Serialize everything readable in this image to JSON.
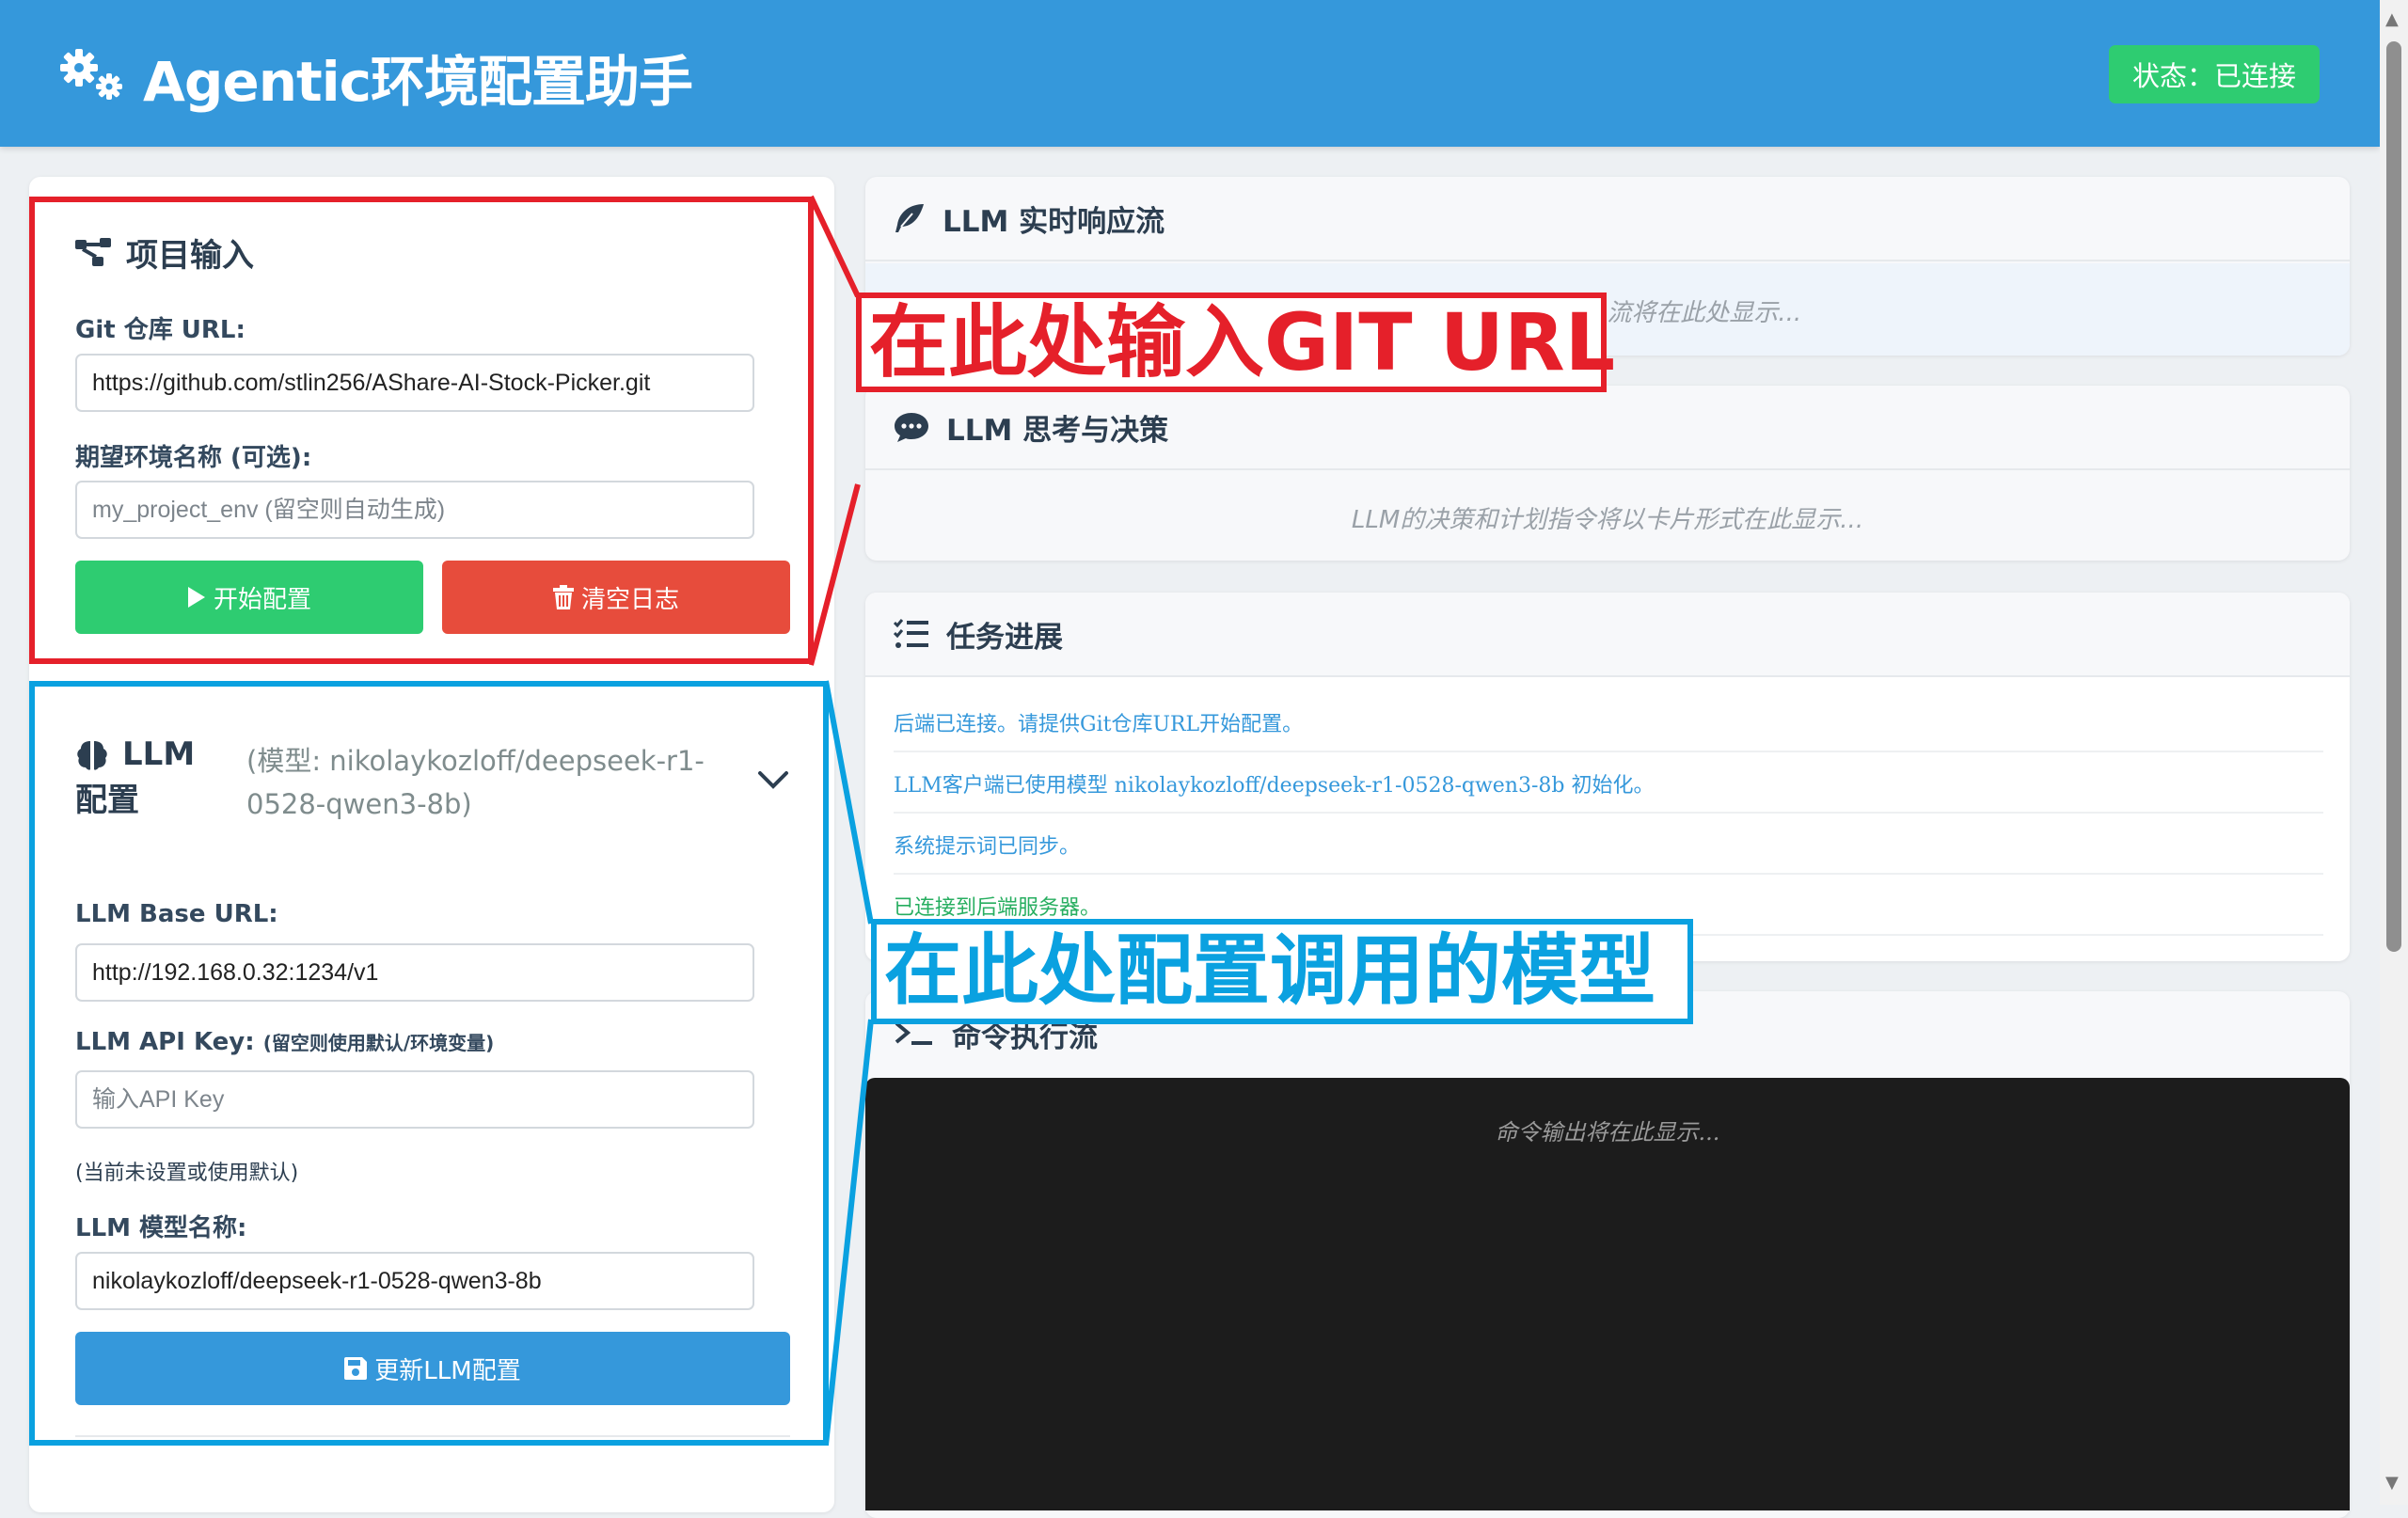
{
  "header": {
    "title": "Agentic环境配置助手",
    "status": "状态：已连接",
    "colors": {
      "bar": "#3598db",
      "status_bg": "#2ecc71"
    }
  },
  "project_input": {
    "title": "项目输入",
    "git_label": "Git 仓库 URL:",
    "git_value": "https://github.com/stlin256/AShare-AI-Stock-Picker.git",
    "env_label": "期望环境名称 (可选):",
    "env_placeholder": "my_project_env (留空则自动生成)",
    "start_button": "开始配置",
    "clear_button": "清空日志"
  },
  "llm_config": {
    "title_line1": "LLM",
    "title_line2": "配置",
    "model_hint": "(模型: nikolaykozloff/deepseek-r1-0528-qwen3-8b)",
    "base_url_label": "LLM Base URL:",
    "base_url_value": "http://192.168.0.32:1234/v1",
    "api_key_label": "LLM API Key:",
    "api_key_label_note": "(留空则使用默认/环境变量)",
    "api_key_placeholder": "输入API Key",
    "api_key_status": "(当前未设置或使用默认)",
    "model_label": "LLM 模型名称:",
    "model_value": "nikolaykozloff/deepseek-r1-0528-qwen3-8b",
    "update_button": "更新LLM配置"
  },
  "stream_card": {
    "title": "LLM 实时响应流",
    "placeholder": "LLM的原始Token流将在此处显示..."
  },
  "thinking_card": {
    "title": "LLM 思考与决策",
    "placeholder": "LLM的决策和计划指令将以卡片形式在此显示..."
  },
  "progress_card": {
    "title": "任务进展",
    "logs": [
      {
        "text": "后端已连接。请提供Git仓库URL开始配置。",
        "color": "#3598db"
      },
      {
        "text": "LLM客户端已使用模型 nikolaykozloff/deepseek-r1-0528-qwen3-8b 初始化。",
        "color": "#3598db"
      },
      {
        "text": "系统提示词已同步。",
        "color": "#3598db"
      },
      {
        "text": "已连接到后端服务器。",
        "color": "#27ae60"
      }
    ]
  },
  "command_card": {
    "title": "命令执行流",
    "placeholder": "命令输出将在此显示..."
  },
  "annotations": {
    "git_callout": "在此处输入GIT URL",
    "llm_callout": "在此处配置调用的模型",
    "colors": {
      "red": "#e5202a",
      "blue": "#0aa1e0"
    }
  }
}
